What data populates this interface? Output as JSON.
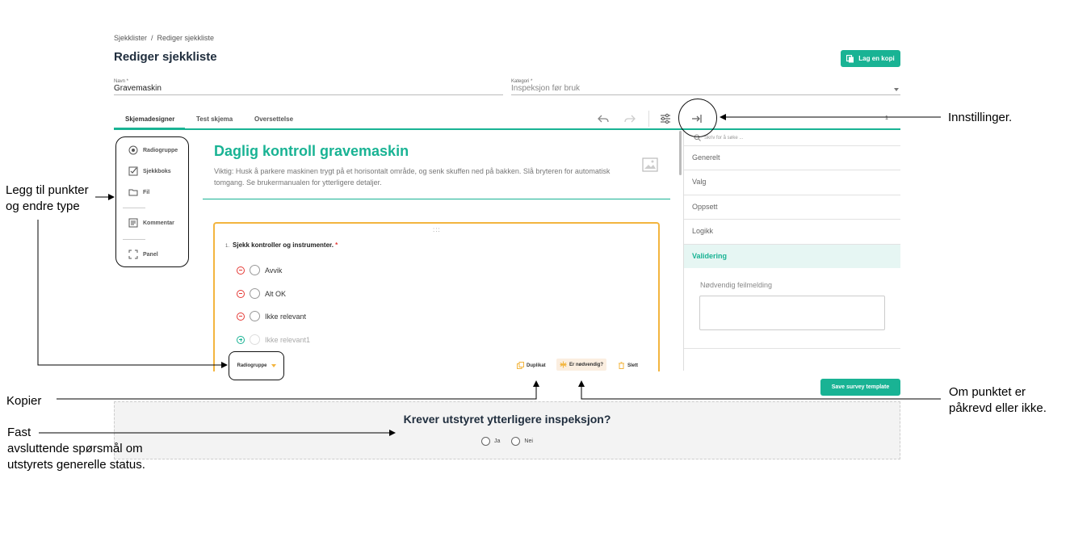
{
  "header": {
    "breadcrumb": [
      "Sjekklister",
      "Rediger sjekkliste"
    ],
    "title": "Rediger sjekkliste",
    "copy_button": "Lag en kopi"
  },
  "form": {
    "name_label": "Navn *",
    "name_value": "Gravemaskin",
    "category_label": "Kategori *",
    "category_value": "Inspeksjon før bruk"
  },
  "tabs": [
    {
      "label": "Skjemadesigner",
      "active": true
    },
    {
      "label": "Test skjema",
      "active": false
    },
    {
      "label": "Oversettelse",
      "active": false
    }
  ],
  "toolbar": {
    "undo_icon": "undo-icon",
    "redo_icon": "redo-icon",
    "settings_icon": "sliders-icon",
    "collapse_icon": "collapse-panel-icon",
    "page_number": "1"
  },
  "toolbox": {
    "items": [
      "Radiogruppe",
      "Sjekkboks",
      "Fil",
      "Kommentar",
      "Panel"
    ]
  },
  "survey": {
    "title": "Daglig kontroll gravemaskin",
    "description": "Viktig: Husk å parkere maskinen trygt på et horisontalt område, og senk skuffen ned på bakken. Slå bryteren for automatisk tomgang. Se brukermanualen for ytterligere detaljer."
  },
  "question": {
    "number": "1.",
    "title": "Sjekk kontroller og instrumenter.",
    "required_mark": "*",
    "drag_handle": ":::",
    "choices": [
      "Avvik",
      "Alt OK",
      "Ikke relevant"
    ],
    "new_choice": "Ikke relevant1",
    "type_label": "Radiogruppe",
    "actions": {
      "duplicate": "Duplikat",
      "required": "Er nødvendig?",
      "delete": "Slett"
    }
  },
  "properties": {
    "search_placeholder": "Skriv for å søke ...",
    "categories": [
      "Generelt",
      "Valg",
      "Oppsett",
      "Logikk",
      "Validering"
    ],
    "active_category": "Validering",
    "field_label": "Nødvendig feilmelding"
  },
  "save_button": "Save survey template",
  "final_question": {
    "title": "Krever utstyret ytterligere inspeksjon?",
    "options": [
      "Ja",
      "Nei"
    ]
  },
  "annotations": {
    "settings": "Innstillinger.",
    "toolbox_line1": "Legg til punkter",
    "toolbox_line2": "og endre type",
    "copy": "Kopier",
    "required_line1": "Om punktet er",
    "required_line2": "påkrevd eller ikke.",
    "fixed_line1": "Fast",
    "fixed_line2": "avsluttende spørsmål om",
    "fixed_line3": "utstyrets generelle status."
  },
  "colors": {
    "accent": "#19b394",
    "selection": "#f3b53f",
    "required": "#e53935"
  }
}
